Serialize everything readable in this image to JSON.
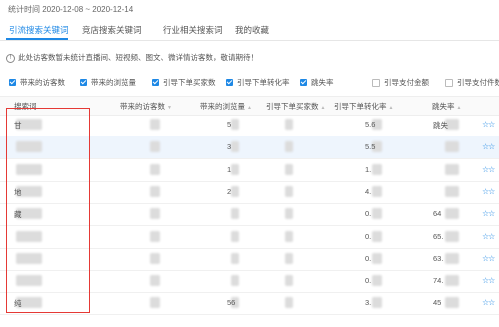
{
  "stat_date": "统计时间 2020-12-08 ~ 2020-12-14",
  "tabs": [
    {
      "label": "引流搜索关键词"
    },
    {
      "label": "竞店搜索关键词"
    },
    {
      "label": "行业相关搜索词"
    },
    {
      "label": "我的收藏"
    }
  ],
  "notice": "此处访客数暂未统计直播间、短视频、图文、微详情访客数，敬请期待！",
  "metrics": [
    {
      "label": "带来的访客数",
      "checked": true
    },
    {
      "label": "带来的浏览量",
      "checked": true
    },
    {
      "label": "引导下单买家数",
      "checked": true
    },
    {
      "label": "引导下单转化率",
      "checked": true
    },
    {
      "label": "跳失率",
      "checked": true
    },
    {
      "label": "引导支付金额",
      "checked": false
    },
    {
      "label": "引导支付件数",
      "checked": false
    }
  ],
  "table": {
    "headers": [
      "搜索词",
      "带来的访客数",
      "带来的浏览量",
      "引导下单买家数",
      "引导下单转化率",
      "跳失率"
    ],
    "rows": [
      {
        "keyword": "甘",
        "visitors": "",
        "views": "5",
        "buyers": "",
        "conversion": "5.6",
        "bounce": "跳失"
      },
      {
        "keyword": "",
        "visitors": "",
        "views": "3",
        "buyers": "",
        "conversion": "5.5",
        "bounce": ""
      },
      {
        "keyword": "",
        "visitors": "",
        "views": "1",
        "buyers": "",
        "conversion": "1.",
        "bounce": ""
      },
      {
        "keyword": "地",
        "visitors": "",
        "views": "2",
        "buyers": "",
        "conversion": "4.",
        "bounce": ""
      },
      {
        "keyword": "藏",
        "visitors": "",
        "views": "",
        "buyers": "",
        "conversion": "0.",
        "bounce": "64"
      },
      {
        "keyword": "",
        "visitors": "",
        "views": "",
        "buyers": "",
        "conversion": "0.",
        "bounce": "65."
      },
      {
        "keyword": "",
        "visitors": "",
        "views": "",
        "buyers": "",
        "conversion": "0.",
        "bounce": "63."
      },
      {
        "keyword": "",
        "visitors": "",
        "views": "",
        "buyers": "",
        "conversion": "0.",
        "bounce": "74."
      },
      {
        "keyword": "纯",
        "visitors": "",
        "views": "56",
        "buyers": "",
        "conversion": "3.",
        "bounce": "45"
      }
    ]
  },
  "actions": {
    "stars": "☆☆"
  },
  "colors": {
    "accent": "#1e88e5",
    "highlight_row": "#eef5fd",
    "annotation": "#e53935"
  }
}
